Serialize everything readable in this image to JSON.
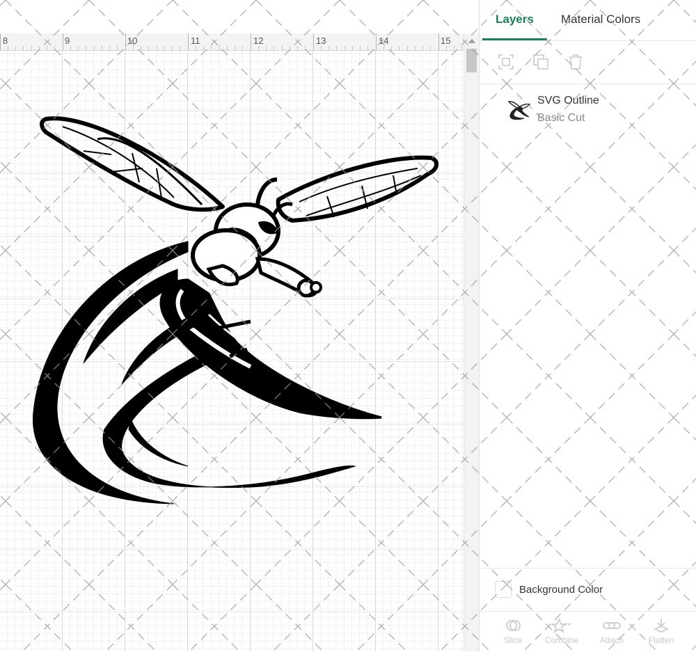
{
  "ruler": {
    "labels": [
      "8",
      "9",
      "10",
      "11",
      "12",
      "13",
      "14",
      "15"
    ]
  },
  "panel": {
    "tabs": [
      {
        "label": "Layers",
        "active": true
      },
      {
        "label": "Material Colors",
        "active": false
      }
    ],
    "toolbar": {
      "icons": [
        "group-icon",
        "duplicate-icon",
        "delete-icon"
      ]
    },
    "layers": [
      {
        "name": "SVG Outline",
        "operation": "Basic Cut",
        "thumbnail": "hornet-icon"
      }
    ],
    "background_color_label": "Background Color",
    "bottom_actions": [
      {
        "label": "Slice",
        "icon": "slice-icon"
      },
      {
        "label": "Combine",
        "icon": "combine-icon"
      },
      {
        "label": "Attach",
        "icon": "attach-icon"
      },
      {
        "label": "Flatten",
        "icon": "flatten-icon"
      }
    ]
  },
  "colors": {
    "accent": "#1a7f5a",
    "artwork": "#000000",
    "disabled": "#c8c8c8"
  }
}
